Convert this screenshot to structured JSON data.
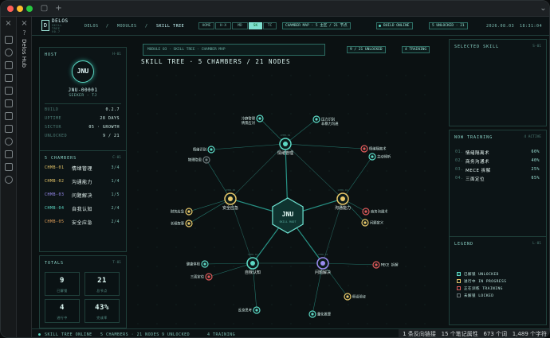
{
  "app": {
    "tab_title": "Delos Hub",
    "status_right": [
      "1 条反向链接",
      "15 个笔记属性",
      "673 个词",
      "1,489 个字符"
    ]
  },
  "header": {
    "logo": "D",
    "brand": "DELOS",
    "brand_sub": [
      "SKILL",
      "TREE",
      "V0.7"
    ],
    "breadcrumb": [
      "DELOS",
      "/",
      "MODULES",
      "/",
      "SKILL TREE"
    ],
    "view_modes": [
      "HOME",
      "H·X",
      "MD",
      "SK",
      "TC"
    ],
    "active_mode": "SK",
    "chamber_map": "CHAMBER MAP · 5 主区 / 21 节点",
    "build": "BUILD ONLINE",
    "unlocked": "5 UNLOCKED · 21",
    "date": "2026.08.03",
    "time": "18:31:04"
  },
  "host": {
    "title": "HOST",
    "code": "H-01",
    "avatar": "JNU",
    "id": "JNU-00001",
    "role": "SEEKER · TJ",
    "rows": [
      {
        "k": "BUILD",
        "v": "0.2.7"
      },
      {
        "k": "UPTIME",
        "v": "28 DAYS"
      },
      {
        "k": "SECTOR",
        "v": "05 · GROWTH"
      },
      {
        "k": "UNLOCKED",
        "v": "9 / 21"
      }
    ]
  },
  "chambers": {
    "title": "5 CHAMBERS",
    "code": "C-01",
    "items": [
      {
        "code": "CHMB-01",
        "name": "情绪管理",
        "count": "3/4",
        "color": "#e8c86a"
      },
      {
        "code": "CHMB-02",
        "name": "沟通能力",
        "count": "1/4",
        "color": "#e8c86a"
      },
      {
        "code": "CHMB-03",
        "name": "问题解决",
        "count": "1/5",
        "color": "#9a8cf0"
      },
      {
        "code": "CHMB-04",
        "name": "自我认知",
        "count": "2/4",
        "color": "#5cd8c4"
      },
      {
        "code": "CHMB-05",
        "name": "安全应急",
        "count": "2/4",
        "color": "#e8a45c"
      }
    ]
  },
  "totals": {
    "title": "TOTALS",
    "code": "T-01",
    "cells": [
      {
        "v": "9",
        "l": "已解锁"
      },
      {
        "v": "21",
        "l": "总节点"
      },
      {
        "v": "4",
        "l": "进行中"
      },
      {
        "v": "43%",
        "l": "完成率"
      }
    ]
  },
  "map": {
    "crumb": "MODULE 03 · SKILL TREE · CHAMBER MAP",
    "title": "SKILL TREE · 5 CHAMBERS / 21 NODES",
    "btn1": "9 / 21 UNLOCKED",
    "btn2": "4 TRAINING",
    "center": "JNU",
    "center_sub": "SKILL ROOT",
    "hubs": [
      {
        "id": "h1",
        "label": "情绪管理",
        "tag": "CHMB-01",
        "color": "#5cd8c4"
      },
      {
        "id": "h2",
        "label": "沟通能力",
        "tag": "CHMB-02",
        "color": "#e8c86a"
      },
      {
        "id": "h3",
        "label": "问题解决",
        "tag": "CHMB-03",
        "color": "#9a8cf0"
      },
      {
        "id": "h4",
        "label": "自我认知",
        "tag": "CHMB-04",
        "color": "#5cd8c4"
      },
      {
        "id": "h5",
        "label": "安全应急",
        "tag": "CHMB-05",
        "color": "#e8c86a"
      }
    ],
    "leaves": [
      {
        "id": "l1",
        "hub": "h1",
        "label": "冷静管理",
        "label2": "情景应对",
        "state": "unlocked"
      },
      {
        "id": "l2",
        "hub": "h1",
        "label": "压力识别",
        "label2": "非暴力沟通",
        "state": "unlocked"
      },
      {
        "id": "l3",
        "hub": "h1",
        "label": "情绪识别",
        "state": "unlocked"
      },
      {
        "id": "l4",
        "hub": "h1",
        "label": "情绪隔离术",
        "state": "training"
      },
      {
        "id": "l5",
        "hub": "h2",
        "label": "主动倾听",
        "state": "unlocked"
      },
      {
        "id": "l6",
        "hub": "h2",
        "label": "商务沟通术",
        "state": "training"
      },
      {
        "id": "l7",
        "hub": "h2",
        "label": "问题定义",
        "state": "progress"
      },
      {
        "id": "l8",
        "hub": "h5",
        "label": "物理隐患",
        "state": "locked"
      },
      {
        "id": "l9",
        "hub": "h5",
        "label": "财务应急",
        "state": "progress"
      },
      {
        "id": "l10",
        "hub": "h5",
        "label": "长程叙事",
        "state": "progress"
      },
      {
        "id": "l11",
        "hub": "h4",
        "label": "健康体检",
        "state": "unlocked"
      },
      {
        "id": "l12",
        "hub": "h4",
        "label": "三面定位",
        "state": "training"
      },
      {
        "id": "l13",
        "hub": "h4",
        "label": "反身思考",
        "state": "unlocked"
      },
      {
        "id": "l14",
        "hub": "h3",
        "label": "MECE 拆解",
        "state": "training"
      },
      {
        "id": "l15",
        "hub": "h3",
        "label": "假设验证",
        "state": "progress"
      },
      {
        "id": "l16",
        "hub": "h3",
        "label": "量化推算",
        "state": "unlocked"
      }
    ]
  },
  "selected": {
    "title": "SELECTED SKILL",
    "code": "S-01"
  },
  "training": {
    "title": "NOW TRAINING",
    "code": "4 ACTIVE",
    "items": [
      {
        "num": "01.",
        "name": "情绪隔离术",
        "pct": "60%"
      },
      {
        "num": "02.",
        "name": "商务沟通术",
        "pct": "40%"
      },
      {
        "num": "03.",
        "name": "MECE 拆解",
        "pct": "25%"
      },
      {
        "num": "04.",
        "name": "三面定位",
        "pct": "65%"
      }
    ]
  },
  "legend": {
    "title": "LEGEND",
    "code": "L-01",
    "items": [
      {
        "label": "已解锁 UNLOCKED",
        "color": "#5cd8c4"
      },
      {
        "label": "进行中 IN PROGRESS",
        "color": "#e8c86a"
      },
      {
        "label": "正在训练 TRAINING",
        "color": "#e05a5a"
      },
      {
        "label": "未解锁 LOCKED",
        "color": "#6c7779"
      }
    ]
  },
  "footer": [
    "SKILL TREE ONLINE",
    "5 CHAMBERS · 21 NODES",
    "9 UNLOCKED",
    "4 TRAINING"
  ],
  "colors": {
    "accent": "#5cd8c4",
    "gold": "#e8c86a",
    "red": "#e05a5a",
    "violet": "#9a8cf0"
  }
}
